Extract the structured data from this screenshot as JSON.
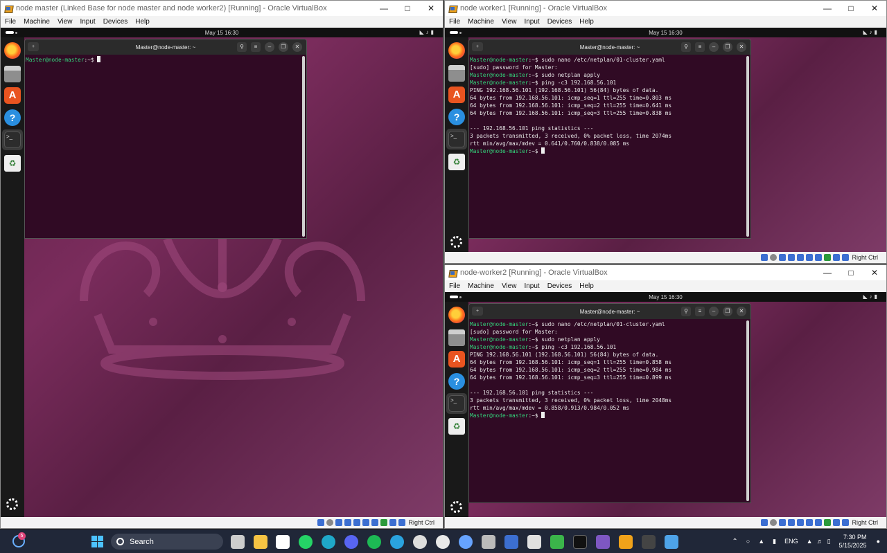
{
  "menu": [
    "File",
    "Machine",
    "View",
    "Input",
    "Devices",
    "Help"
  ],
  "windows": {
    "master": {
      "title": "node master (Linked Base for node master and node worker2) [Running] - Oracle VirtualBox",
      "clock": "May 15  16:30",
      "terminal_title": "Master@node-master: ~",
      "prompt": "Master@node-master",
      "prompt_suffix": ":~$ "
    },
    "worker1": {
      "title": "node worker1 [Running] - Oracle VirtualBox",
      "clock": "May 15  16:30",
      "terminal_title": "Master@node-master: ~",
      "prompt": "Master@node-master",
      "lines": [
        {
          "p": true,
          "t": ":~$ sudo nano /etc/netplan/01-cluster.yaml"
        },
        {
          "p": false,
          "t": "[sudo] password for Master:"
        },
        {
          "p": true,
          "t": ":~$ sudo netplan apply"
        },
        {
          "p": true,
          "t": ":~$ ping -c3 192.168.56.101"
        },
        {
          "p": false,
          "t": "PING 192.168.56.101 (192.168.56.101) 56(84) bytes of data."
        },
        {
          "p": false,
          "t": "64 bytes from 192.168.56.101: icmp_seq=1 ttl=255 time=0.803 ms"
        },
        {
          "p": false,
          "t": "64 bytes from 192.168.56.101: icmp_seq=2 ttl=255 time=0.641 ms"
        },
        {
          "p": false,
          "t": "64 bytes from 192.168.56.101: icmp_seq=3 ttl=255 time=0.838 ms"
        },
        {
          "p": false,
          "t": ""
        },
        {
          "p": false,
          "t": "--- 192.168.56.101 ping statistics ---"
        },
        {
          "p": false,
          "t": "3 packets transmitted, 3 received, 0% packet loss, time 2074ms"
        },
        {
          "p": false,
          "t": "rtt min/avg/max/mdev = 0.641/0.760/0.838/0.085 ms"
        },
        {
          "p": true,
          "t": ":~$ ",
          "cursor": true
        }
      ]
    },
    "worker2": {
      "title": "node-worker2 [Running] - Oracle VirtualBox",
      "clock": "May 15  16:30",
      "terminal_title": "Master@node-master: ~",
      "prompt": "Master@node-master",
      "lines": [
        {
          "p": true,
          "t": ":~$ sudo nano /etc/netplan/01-cluster.yaml"
        },
        {
          "p": false,
          "t": "[sudo] password for Master:"
        },
        {
          "p": true,
          "t": ":~$ sudo netplan apply"
        },
        {
          "p": true,
          "t": ":~$ ping -c3 192.168.56.101"
        },
        {
          "p": false,
          "t": "PING 192.168.56.101 (192.168.56.101) 56(84) bytes of data."
        },
        {
          "p": false,
          "t": "64 bytes from 192.168.56.101: icmp_seq=1 ttl=255 time=0.858 ms"
        },
        {
          "p": false,
          "t": "64 bytes from 192.168.56.101: icmp_seq=2 ttl=255 time=0.984 ms"
        },
        {
          "p": false,
          "t": "64 bytes from 192.168.56.101: icmp_seq=3 ttl=255 time=0.899 ms"
        },
        {
          "p": false,
          "t": ""
        },
        {
          "p": false,
          "t": "--- 192.168.56.101 ping statistics ---"
        },
        {
          "p": false,
          "t": "3 packets transmitted, 3 received, 0% packet loss, time 2048ms"
        },
        {
          "p": false,
          "t": "rtt min/avg/max/mdev = 0.858/0.913/0.984/0.052 ms"
        },
        {
          "p": true,
          "t": ":~$ ",
          "cursor": true
        }
      ]
    }
  },
  "host_key": "Right Ctrl",
  "taskbar": {
    "search_label": "Search",
    "lang": "ENG",
    "time": "7:30 PM",
    "date": "5/15/2025",
    "notification_count": "5"
  },
  "colors": {
    "guest_bg": "#6e2a56",
    "terminal_bg": "#300a24",
    "prompt": "#33d17a",
    "taskbar": "#202738"
  }
}
